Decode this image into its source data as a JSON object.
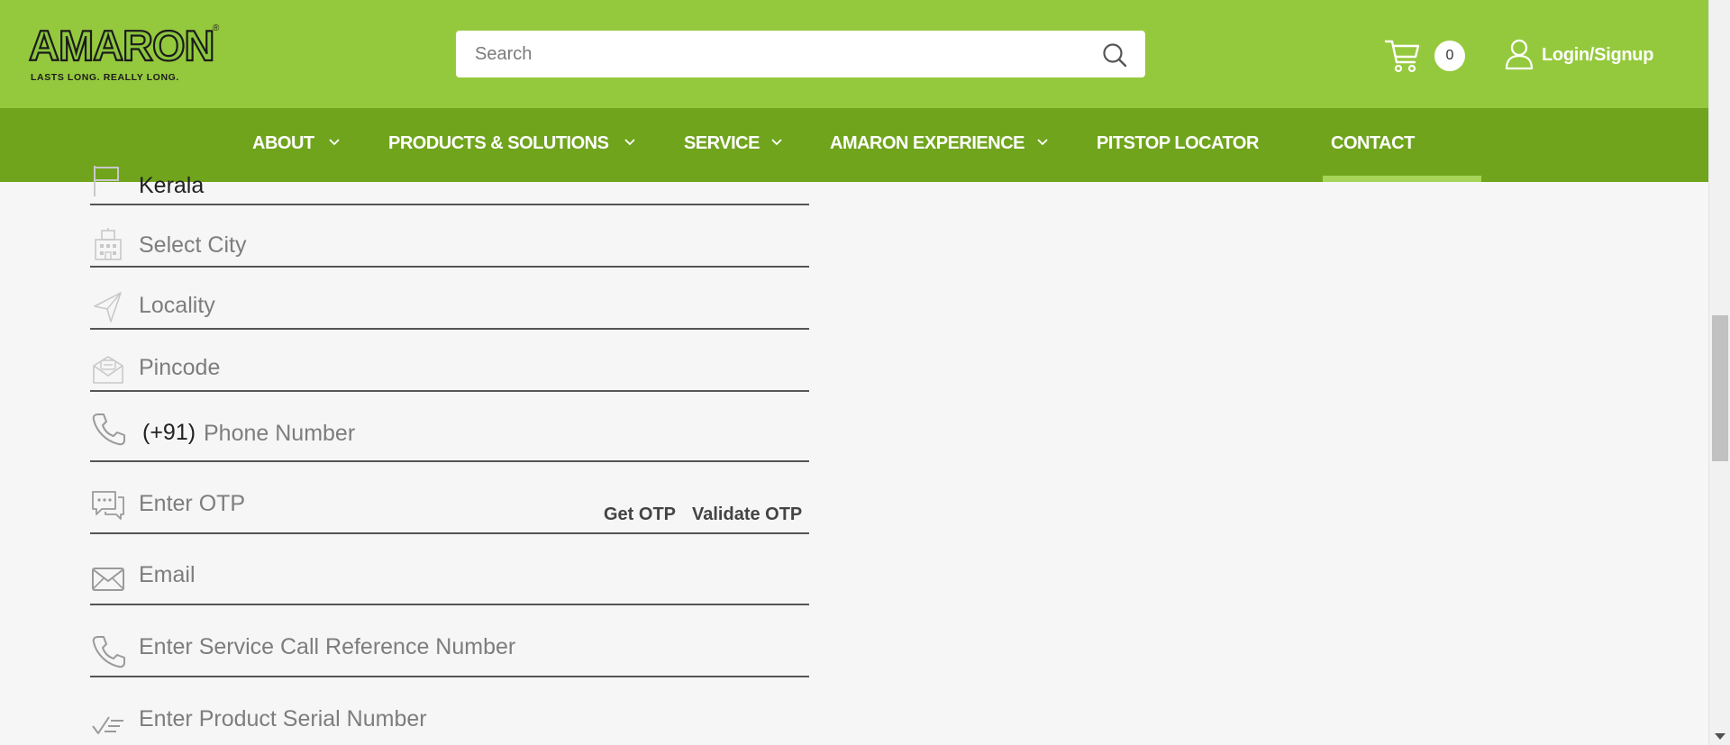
{
  "header": {
    "logo": {
      "wordmark": "AMARON",
      "trademark": "®",
      "tagline": "LASTS LONG. REALLY LONG."
    },
    "search": {
      "placeholder": "Search",
      "value": ""
    },
    "cart": {
      "count": "0",
      "icon": "cart-icon"
    },
    "login_label": "Login/Signup",
    "colors": {
      "top": "#95c93d",
      "nav": "#70a41c",
      "active": "#a6d559"
    }
  },
  "nav": {
    "items": [
      {
        "label": "ABOUT",
        "has_dropdown": true
      },
      {
        "label": "PRODUCTS & SOLUTIONS",
        "has_dropdown": true
      },
      {
        "label": "SERVICE",
        "has_dropdown": true
      },
      {
        "label": "AMARON EXPERIENCE",
        "has_dropdown": true
      },
      {
        "label": "PITSTOP LOCATOR",
        "has_dropdown": false
      },
      {
        "label": "CONTACT",
        "has_dropdown": false,
        "active": true
      }
    ]
  },
  "form": {
    "state": {
      "value": "Kerala",
      "icon": "flag-icon"
    },
    "city": {
      "placeholder": "Select City",
      "icon": "building-icon"
    },
    "locality": {
      "placeholder": "Locality",
      "icon": "location-arrow-icon"
    },
    "pincode": {
      "placeholder": "Pincode",
      "icon": "envelope-pin-icon"
    },
    "phone": {
      "prefix": "(+91)",
      "placeholder": "Phone Number",
      "icon": "phone-icon"
    },
    "otp": {
      "placeholder": "Enter OTP",
      "get_label": "Get OTP",
      "validate_label": "Validate OTP",
      "icon": "chat-icon"
    },
    "email": {
      "placeholder": "Email",
      "icon": "mail-icon"
    },
    "service_ref": {
      "placeholder": "Enter Service Call Reference Number",
      "icon": "phone-icon"
    },
    "serial": {
      "placeholder": "Enter Product Serial Number",
      "icon": "checklist-icon"
    }
  }
}
